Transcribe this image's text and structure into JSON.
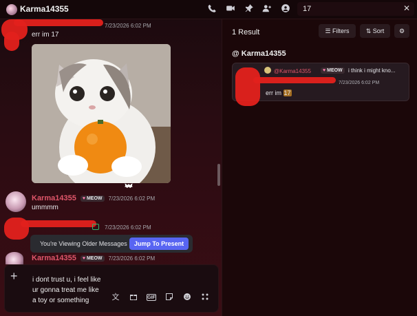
{
  "header": {
    "channel_title": "Karma14355",
    "search_value": "17"
  },
  "chat": {
    "messages": [
      {
        "time": "7/23/2026 6:02 PM",
        "text": "err im 17"
      },
      {
        "name": "Karma14355",
        "badge": "MEOW",
        "time": "7/23/2026 6:02 PM",
        "text": "ummmm"
      },
      {
        "time": "7/23/2026 6:02 PM"
      },
      {
        "name": "Karma14355",
        "badge": "MEOW",
        "time": "7/23/2026 6:02 PM"
      }
    ],
    "older_banner": {
      "text": "You're Viewing Older Messages",
      "button": "Jump To Present"
    },
    "composer": {
      "text": "i dont trust u, i feel like\nur gonna treat me like\na toy or something"
    }
  },
  "search_panel": {
    "result_count": "1 Result",
    "filters_label": "Filters",
    "sort_label": "Sort",
    "channel_heading": "@ Karma14355",
    "result": {
      "name": "@Karma14355",
      "badge": "MEOW",
      "reply_preview": "i think i might kno...",
      "time": "7/23/2026 6:02 PM",
      "text_before": "err im ",
      "highlight": "17"
    }
  },
  "colors": {
    "accent": "#5865f2",
    "username": "#e0566a",
    "highlight": "#a56f22"
  }
}
